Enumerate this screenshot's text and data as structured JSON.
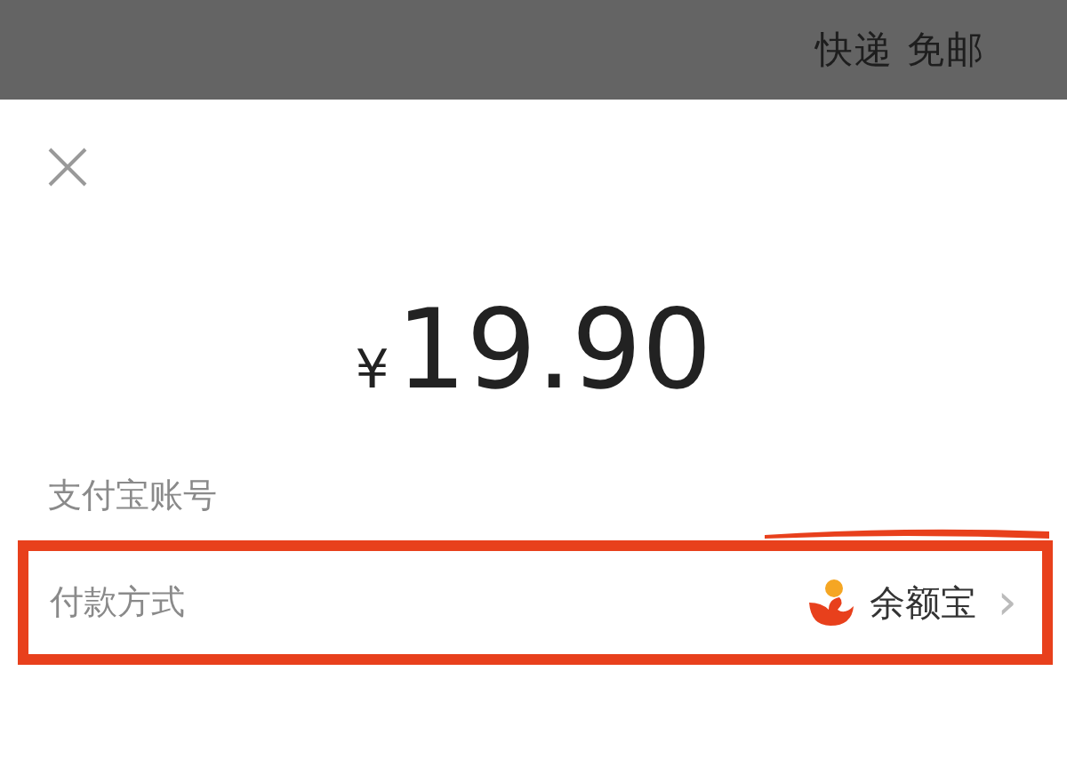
{
  "top_bar": {
    "text": "快递 免邮"
  },
  "payment": {
    "currency": "¥",
    "amount": "19.90",
    "account_label": "支付宝账号",
    "method_label": "付款方式",
    "method_value": "余额宝",
    "chevron": "›"
  }
}
